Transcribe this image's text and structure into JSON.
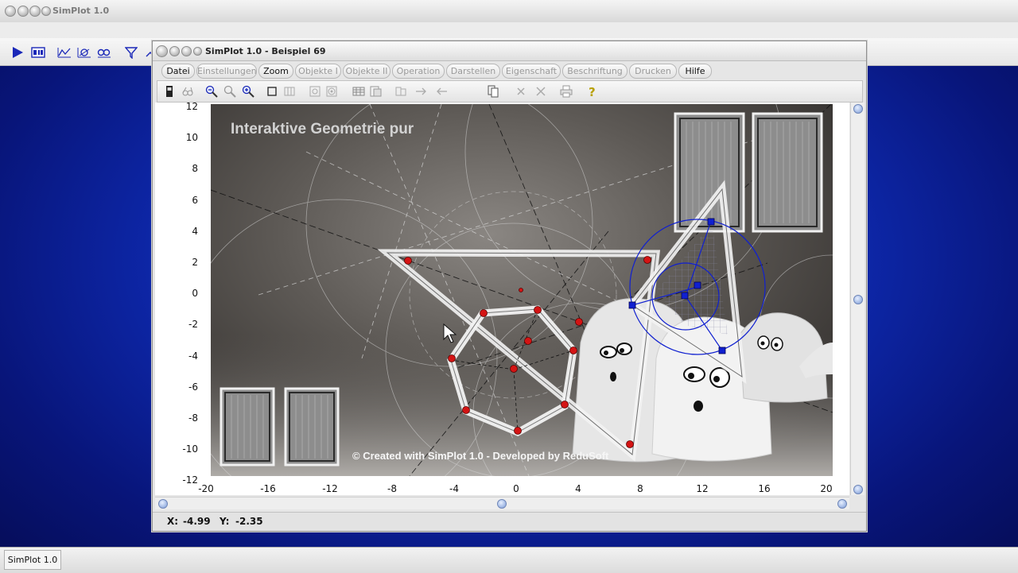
{
  "outer_window": {
    "title": "SimPlot 1.0"
  },
  "outer_toolbar": {
    "icons": [
      "play-icon",
      "calculator-icon",
      "function-plot-icon",
      "parametric-plot-icon",
      "data-plot-icon",
      "filter-icon"
    ]
  },
  "taskbar": {
    "button_label": "SimPlot 1.0"
  },
  "inner_window": {
    "title": "SimPlot 1.0 - Beispiel 69",
    "menu": [
      {
        "label": "Datei",
        "enabled": true
      },
      {
        "label": "Einstellungen",
        "enabled": false
      },
      {
        "label": "Zoom",
        "enabled": true
      },
      {
        "label": "Objekte I",
        "enabled": false
      },
      {
        "label": "Objekte II",
        "enabled": false
      },
      {
        "label": "Operation",
        "enabled": false
      },
      {
        "label": "Darstellen",
        "enabled": false
      },
      {
        "label": "Eigenschaft",
        "enabled": false
      },
      {
        "label": "Beschriftung",
        "enabled": false
      },
      {
        "label": "Drucken",
        "enabled": false
      },
      {
        "label": "Hilfe",
        "enabled": true
      }
    ],
    "toolbar_icons": [
      "phone-icon",
      "glasses-icon",
      "zoom-out-icon",
      "zoom-reset-icon",
      "zoom-in-icon",
      "frame-icon",
      "resize-icon",
      "circle-icon",
      "target-icon",
      "table-icon",
      "export-icon",
      "copy-icon",
      "arrow-right-icon",
      "arrow-left-icon",
      "document-icon",
      "cross-icon",
      "cross-alt-icon",
      "print-icon",
      "help-icon"
    ]
  },
  "plot": {
    "heading": "Interaktive Geometrie pur",
    "credit": "© Created with SimPlot 1.0 - Developed by ReduSoft",
    "y_ticks": [
      "12",
      "10",
      "8",
      "6",
      "4",
      "2",
      "0",
      "-2",
      "-4",
      "-6",
      "-8",
      "-10",
      "-12"
    ],
    "x_ticks": [
      "-20",
      "-16",
      "-12",
      "-8",
      "-4",
      "0",
      "4",
      "8",
      "12",
      "16",
      "20"
    ],
    "x_range": [
      -20,
      20
    ],
    "y_range": [
      -12,
      12
    ]
  },
  "status": {
    "x_label": "X:",
    "x_value": "-4.99",
    "y_label": "Y:",
    "y_value": "-2.35"
  },
  "colors": {
    "desktop": "#1030c0",
    "point_red": "#d41414",
    "point_blue": "#1020d0"
  }
}
